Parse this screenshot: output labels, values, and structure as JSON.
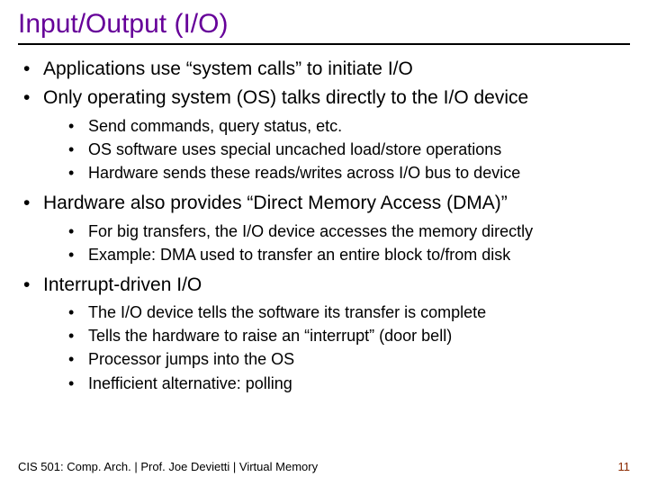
{
  "title": "Input/Output (I/O)",
  "bullets": {
    "b0": "Applications use “system calls” to initiate I/O",
    "b1": "Only operating system (OS) talks directly to the I/O device",
    "b1_sub": {
      "s0": "Send commands, query status, etc.",
      "s1": "OS software uses special uncached load/store operations",
      "s2": "Hardware sends these reads/writes across I/O bus to device"
    },
    "b2": "Hardware also provides “Direct Memory Access (DMA)”",
    "b2_sub": {
      "s0": "For big transfers, the I/O device accesses the memory directly",
      "s1": "Example: DMA used to transfer an entire block to/from disk"
    },
    "b3": "Interrupt-driven I/O",
    "b3_sub": {
      "s0": "The I/O device tells the software its transfer is complete",
      "s1": "Tells the hardware to raise an “interrupt” (door bell)",
      "s2": "Processor jumps into the OS",
      "s3": "Inefficient alternative: polling"
    }
  },
  "footer": {
    "left": "CIS 501: Comp. Arch.  |  Prof. Joe Devietti  |  Virtual Memory",
    "page": "11"
  }
}
